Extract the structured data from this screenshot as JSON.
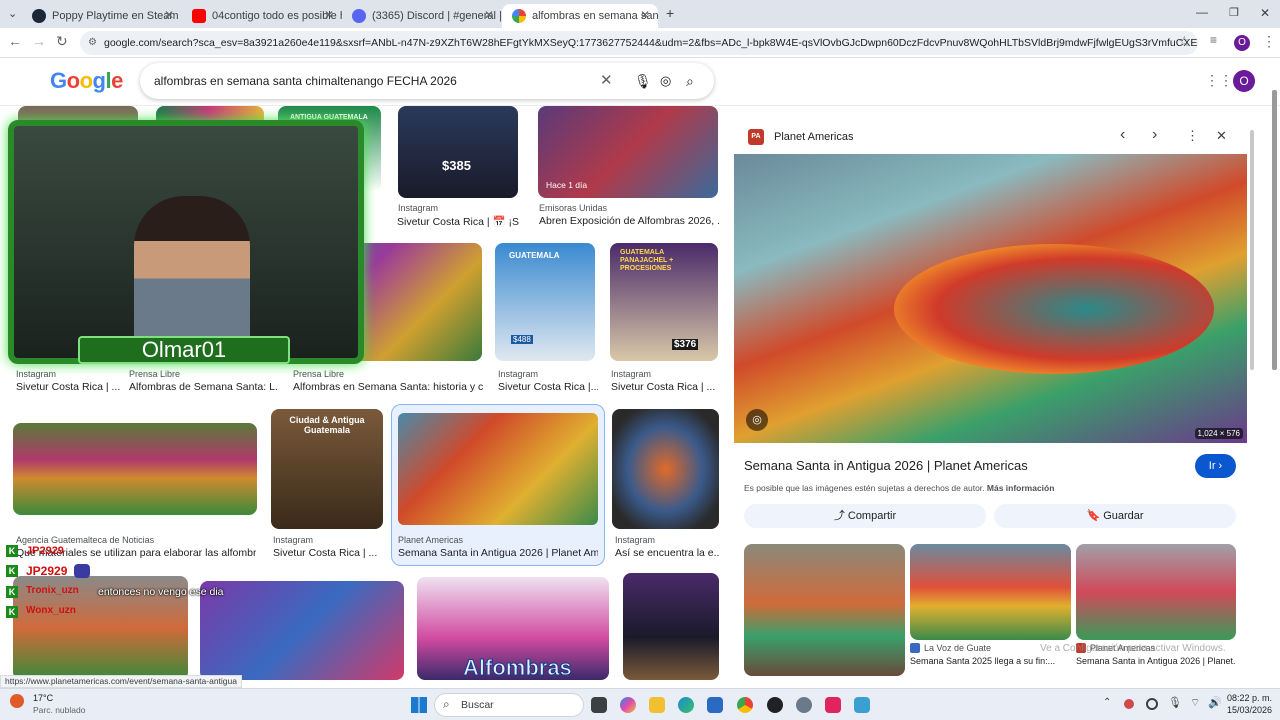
{
  "browser": {
    "tabs": [
      {
        "title": "Poppy Playtime en Steam",
        "color": "#1b2838"
      },
      {
        "title": "04contigo todo es posible hasta",
        "color": "#ff0000"
      },
      {
        "title": "(3365) Discord | #general | Olm",
        "color": "#5865f2"
      },
      {
        "title": "alfombras en semana santa chi",
        "color": "#4285f4"
      }
    ],
    "new_tab_icon": "+",
    "url": "google.com/search?sca_esv=8a3921a260e4e119&sxsrf=ANbL-n47N-z9XZhT6W28hEFgtYkMXSeyQ:1773627752444&udm=2&fbs=ADc_l-bpk8W4E-qsVlOvbGJcDwpn60DczFdcvPnuv8WQohHLTbSVldBrj9mdwFjfwlgEUgS3rVmfuCXEBMRJMD3ur3wa2tCLws88..."
  },
  "google": {
    "logo": "Google",
    "query": "alfombras en semana santa chimaltenango FECHA 2026",
    "account_initial": "O"
  },
  "stream": {
    "name": "Olmar01",
    "chat": [
      {
        "user": "JP2929",
        "msg": ""
      },
      {
        "user": "Tronix_uzn",
        "msg": "entonces no vengo ese dia"
      },
      {
        "user": "Wonx_uzn",
        "msg": ""
      }
    ]
  },
  "results": [
    {
      "source": "Instagram",
      "title": "Sivetur Costa Rica | 📅 ¡S..."
    },
    {
      "source": "Emisoras Unidas",
      "title": "Abren Exposición de Alfombras 2026, ..."
    },
    {
      "source": "Instagram",
      "title": "Sivetur Costa Rica | ..."
    },
    {
      "source": "Prensa Libre",
      "title": "Alfombras de Semana Santa: L..."
    },
    {
      "source": "Prensa Libre",
      "title": "Alfombras en Semana Santa: historia y c..."
    },
    {
      "source": "Instagram",
      "title": "Sivetur Costa Rica |..."
    },
    {
      "source": "Instagram",
      "title": "Sivetur Costa Rica | ..."
    },
    {
      "source": "Agencia Guatemalteca de Noticias",
      "title": "Qué materiales se utilizan para elaborar las alfombra..."
    },
    {
      "source": "Instagram",
      "title": "Sivetur Costa Rica | ..."
    },
    {
      "source": "Planet Americas",
      "title": "Semana Santa in Antigua 2026 | Planet Am..."
    },
    {
      "source": "Instagram",
      "title": "Así se encuentra la e..."
    }
  ],
  "image_labels": {
    "price_385": "$385",
    "price_376": "$376",
    "price_488": "$488",
    "hace": "Hace 1 día",
    "guatemala": "GUATEMALA",
    "guatemala_pana": "GUATEMALA PANAJACHEL + PROCESIONES",
    "ciudad": "Ciudad & Antigua Guatemala",
    "antigua": "ANTIGUA GUATEMALA",
    "alfombras": "Alfombras"
  },
  "panel": {
    "source": "Planet Americas",
    "source_badge": "PA",
    "dimensions": "1,024 × 576",
    "title": "Semana Santa in Antigua 2026 | Planet Americas",
    "visit_label": "Ir",
    "copyright": "Es posible que las imágenes estén sujetas a derechos de autor.",
    "more_info": "Más información",
    "share_label": "Compartir",
    "save_label": "Guardar",
    "related": [
      {
        "source": "",
        "title": ""
      },
      {
        "source": "La Voz de Guate",
        "title": "Semana Santa 2025 llega a su fin:..."
      },
      {
        "source": "Planet Americas",
        "title": "Semana Santa in Antigua 2026 | Planet..."
      }
    ]
  },
  "status_url": "https://www.planetamericas.com/event/semana-santa-antigua",
  "activate_windows": "Ve a Configuración para activar Windows.",
  "taskbar": {
    "temp": "17°C",
    "weather": "Parc. nublado",
    "search": "Buscar",
    "time": "08:22 p. m.",
    "date": "15/03/2026"
  }
}
